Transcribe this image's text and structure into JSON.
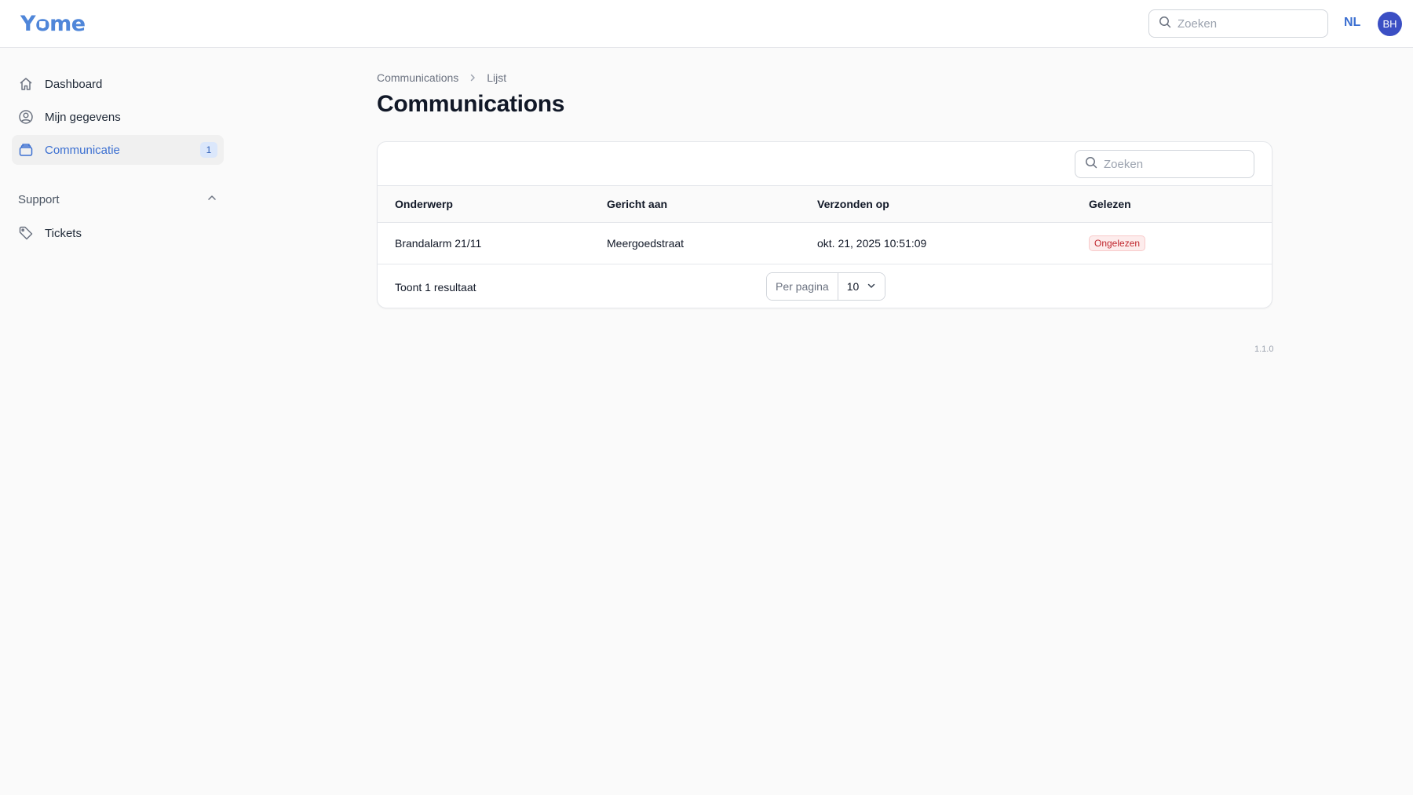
{
  "app": {
    "logo_text_before": "Y",
    "logo_text_o": "o",
    "logo_text_after": "me"
  },
  "header": {
    "search_placeholder": "Zoeken",
    "language": "NL",
    "avatar_initials": "BH"
  },
  "sidebar": {
    "items": [
      {
        "label": "Dashboard",
        "icon": "home-icon"
      },
      {
        "label": "Mijn gegevens",
        "icon": "user-circle-icon"
      },
      {
        "label": "Communicatie",
        "icon": "inbox-icon",
        "badge": "1",
        "active": true
      }
    ],
    "group": {
      "label": "Support",
      "items": [
        {
          "label": "Tickets",
          "icon": "tag-icon"
        }
      ]
    }
  },
  "breadcrumb": {
    "root": "Communications",
    "current": "Lijst"
  },
  "page": {
    "title": "Communications"
  },
  "table": {
    "search_placeholder": "Zoeken",
    "columns": [
      "Onderwerp",
      "Gericht aan",
      "Verzonden op",
      "Gelezen"
    ],
    "rows": [
      {
        "subject": "Brandalarm 21/11",
        "recipient": "Meergoedstraat",
        "sent_at": "okt. 21, 2025 10:51:09",
        "status": "Ongelezen"
      }
    ],
    "result_count": "Toont 1 resultaat",
    "per_page_label": "Per pagina",
    "per_page_value": "10"
  },
  "footer": {
    "version": "1.1.0"
  },
  "colors": {
    "accent": "#3b6fd1",
    "avatar": "#3b4fc4",
    "unread": "#c0262d"
  }
}
